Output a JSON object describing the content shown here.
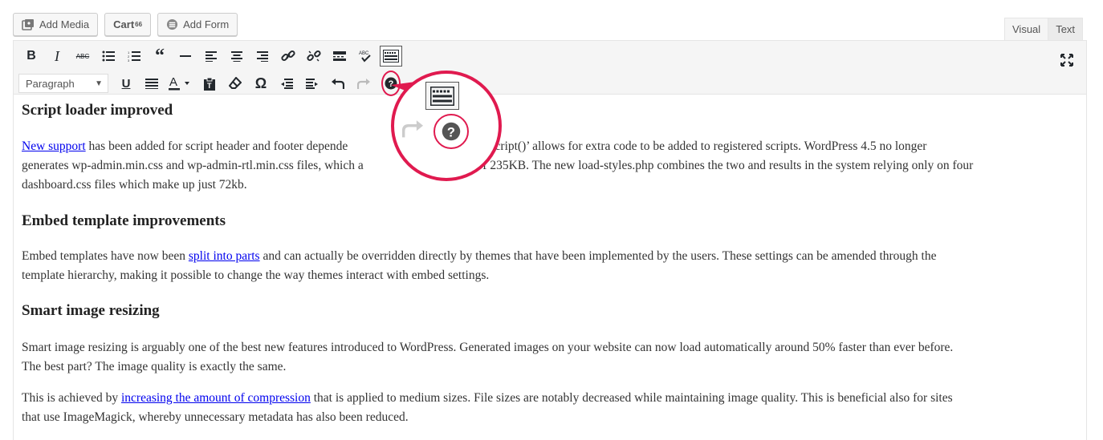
{
  "media_buttons": {
    "add_media": "Add Media",
    "cart": "Cart",
    "cart_sup": "66",
    "add_form": "Add Form"
  },
  "mode_tabs": {
    "visual": "Visual",
    "text": "Text"
  },
  "toolbar": {
    "format_select": "Paragraph",
    "row1_icons": [
      "bold-icon",
      "italic-icon",
      "strikethrough-icon",
      "bulleted-list-icon",
      "numbered-list-icon",
      "blockquote-icon",
      "horizontal-line-icon",
      "align-left-icon",
      "align-center-icon",
      "align-right-icon",
      "insert-link-icon",
      "remove-link-icon",
      "read-more-icon",
      "spellcheck-icon",
      "toolbar-toggle-icon",
      "fullscreen-icon"
    ],
    "row2_icons": [
      "underline-icon",
      "justify-icon",
      "text-color-icon",
      "paste-text-icon",
      "clear-formatting-icon",
      "special-character-icon",
      "outdent-icon",
      "indent-icon",
      "undo-icon",
      "redo-icon",
      "keyboard-shortcuts-help-icon"
    ]
  },
  "accent_color": "#e01a4f",
  "content": {
    "h1": "Script loader improved",
    "p1_link": "New support",
    "p1_a": " has been added for script header and footer depende",
    "p1_b": "_add_inlinescript()’ allows for extra code to be added to registered scripts. WordPress 4.5 no longer",
    "p1_line2a": "generates wp-admin.min.css and wp-admin-rtl.min.css files, which a",
    "p1_line2b": "ess of 235KB. The new load-styles.php combines the two and results in the system relying only on four",
    "p1_line3": "dashboard.css files which make up just 72kb.",
    "h2": "Embed template improvements",
    "p2_a": "Embed templates have now been ",
    "p2_link": "split into parts",
    "p2_b": " and can actually be overridden directly by themes that have been implemented by the users. These settings can be amended through the",
    "p2_line2": "template hierarchy, making it possible to change the way themes interact with embed settings.",
    "h3": "Smart image resizing",
    "p3_line1": "Smart image resizing is arguably one of the best new features introduced to WordPress. Generated images on your website can now load automatically around 50% faster than ever before.",
    "p3_line2": "The best part? The image quality is exactly the same.",
    "p4_a": "This is achieved by ",
    "p4_link": "increasing the amount of compression",
    "p4_b": " that is applied to medium sizes. File sizes are notably decreased while maintaining image quality. This is beneficial also for sites",
    "p4_line2": "that use ImageMagick, whereby unnecessary metadata has also been reduced."
  }
}
